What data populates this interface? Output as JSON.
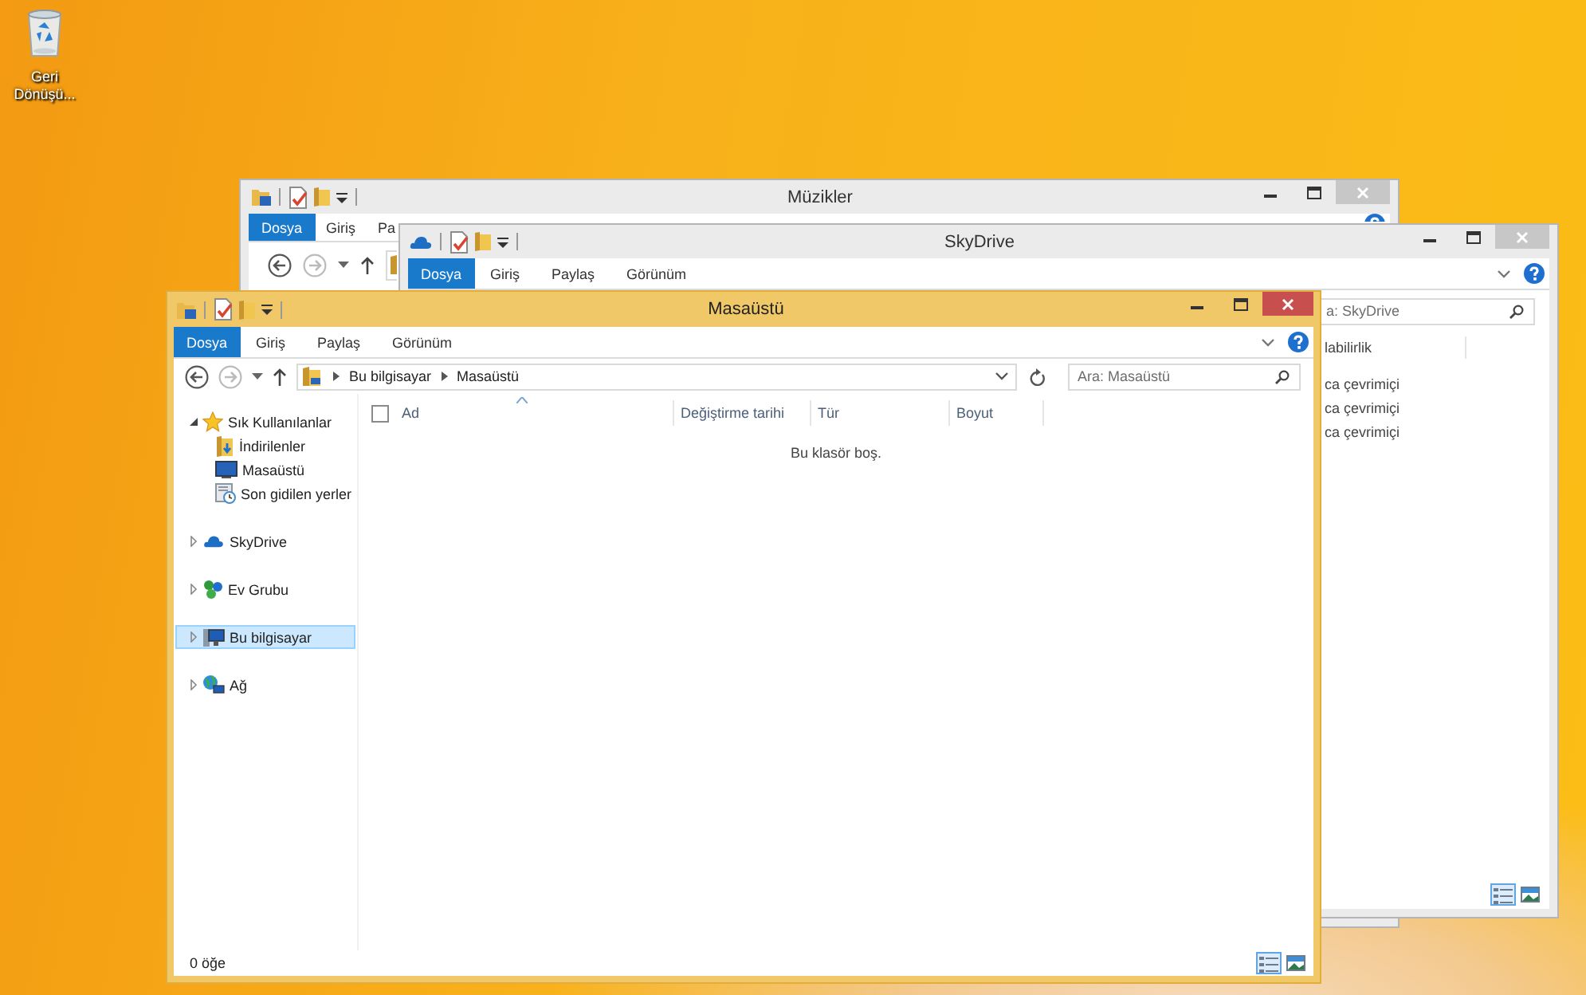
{
  "desktop_icons": [
    {
      "label": "Geri Dönüşü..."
    }
  ],
  "windows": [
    {
      "title": "Müzikler",
      "active": false,
      "tabs": [
        {
          "label": "Dosya",
          "selected": true
        },
        {
          "label": "Giriş",
          "selected": false
        },
        {
          "label": "Pa",
          "selected": false
        }
      ]
    },
    {
      "title": "SkyDrive",
      "active": false,
      "tabs": [
        {
          "label": "Dosya",
          "selected": true
        },
        {
          "label": "Giriş",
          "selected": false
        },
        {
          "label": "Paylaş",
          "selected": false
        },
        {
          "label": "Görünüm",
          "selected": false
        }
      ],
      "search": {
        "placeholder": "a: SkyDrive"
      },
      "column_1": "labilirlik",
      "rows": [
        "ca çevrimiçi",
        "ca çevrimiçi",
        "ca çevrimiçi"
      ],
      "views": [
        {
          "selected": true
        },
        {
          "selected": false
        }
      ]
    },
    {
      "title": "Masaüstü",
      "active": true,
      "tabs": [
        {
          "label": "Dosya",
          "selected": true
        },
        {
          "label": "Giriş",
          "selected": false
        },
        {
          "label": "Paylaş",
          "selected": false
        },
        {
          "label": "Görünüm",
          "selected": false
        }
      ],
      "address": [
        "Bu bilgisayar",
        "Masaüstü"
      ],
      "search": {
        "placeholder": "Ara: Masaüstü"
      },
      "navigation": [
        {
          "label": "Sık Kullanılanlar",
          "expanded": true,
          "selected": false,
          "children": [
            {
              "label": "İndirilenler",
              "selected": false
            },
            {
              "label": "Masaüstü",
              "selected": false
            },
            {
              "label": "Son gidilen yerler",
              "selected": false
            }
          ]
        },
        {
          "label": "SkyDrive",
          "expanded": false,
          "selected": false
        },
        {
          "label": "Ev Grubu",
          "expanded": false,
          "selected": false
        },
        {
          "label": "Bu bilgisayar",
          "expanded": false,
          "selected": true
        },
        {
          "label": "Ağ",
          "expanded": false,
          "selected": false
        }
      ],
      "select_all": {
        "checked": false
      },
      "columns": [
        {
          "label": "Ad",
          "sorted": true
        },
        {
          "label": "Değiştirme tarihi",
          "sorted": false
        },
        {
          "label": "Tür",
          "sorted": false
        },
        {
          "label": "Boyut",
          "sorted": false
        }
      ],
      "empty_text": "Bu klasör boş.",
      "status_bar": "0 öğe",
      "views": [
        {
          "selected": true
        },
        {
          "selected": false
        }
      ]
    }
  ]
}
